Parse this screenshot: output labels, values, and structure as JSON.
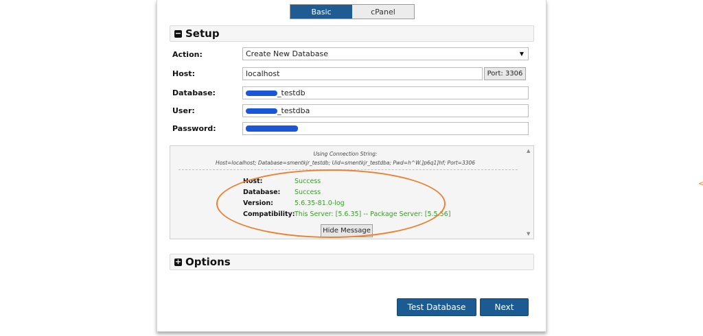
{
  "tabs": [
    {
      "label": "Basic",
      "active": true
    },
    {
      "label": "cPanel",
      "active": false
    }
  ],
  "setup": {
    "title": "Setup",
    "icon": "minus-square-icon",
    "action_label": "Action:",
    "action_value": "Create New Database",
    "host_label": "Host:",
    "host_value": "localhost",
    "port_label": "Port: 3306",
    "database_label": "Database:",
    "database_value": "_testdb",
    "user_label": "User:",
    "user_value": "_testdba",
    "password_label": "Password:"
  },
  "message": {
    "conn_heading": "Using Connection String:",
    "conn_string": "Host=localhost; Database=smentkjr_testdb; Uid=smentkjr_testdba; Pwd=h^W.]p6q1]hf; Port=3306",
    "results": [
      {
        "label": "Host:",
        "value": "Success"
      },
      {
        "label": "Database:",
        "value": "Success"
      },
      {
        "label": "Version:",
        "value": "5.6.35-81.0-log"
      },
      {
        "label": "Compatibility:",
        "value": "This Server: [5.6.35] -- Package Server: [5.5.56]"
      }
    ],
    "hide_label": "Hide Message"
  },
  "options": {
    "title": "Options",
    "icon": "plus-square-icon"
  },
  "buttons": {
    "test_label": "Test Database",
    "next_label": "Next"
  },
  "colors": {
    "accent": "#1f5c93",
    "success": "#3a9a2a",
    "annotation": "#ef7f2c",
    "redaction": "#1c56d8"
  },
  "annotation_arrow": "<"
}
